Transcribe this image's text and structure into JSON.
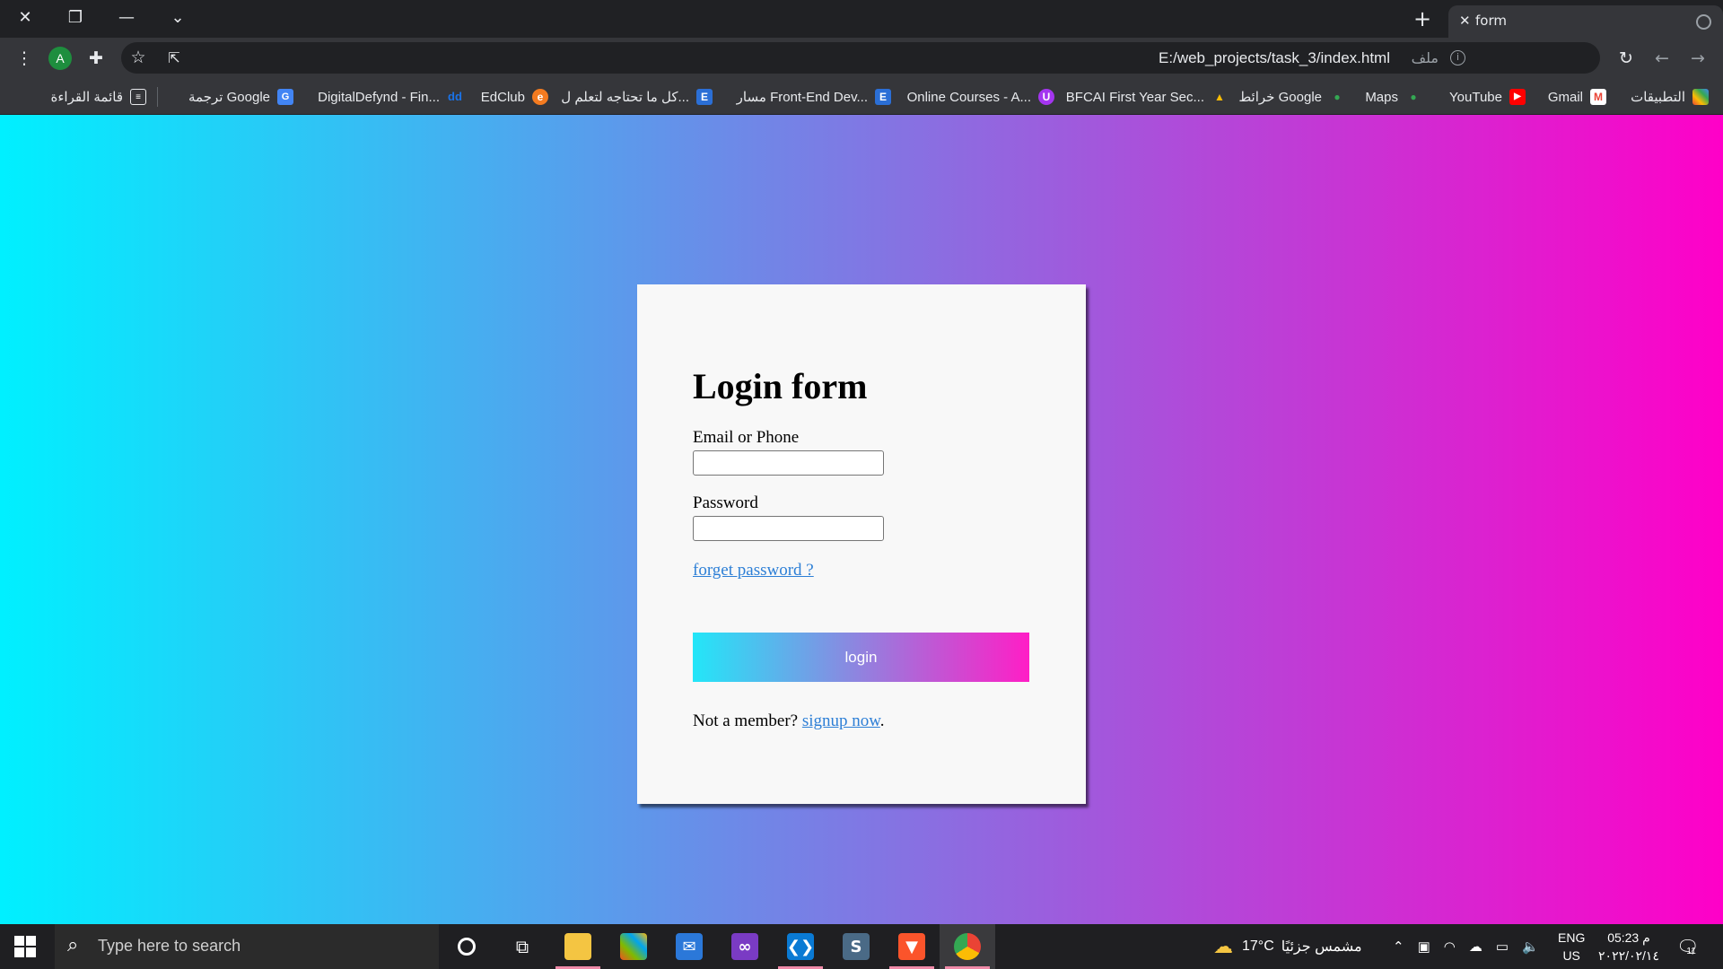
{
  "browser": {
    "tab_title": "form",
    "url": "E:/web_projects/task_3/index.html",
    "site_chip": "ملف",
    "profile_initial": "A"
  },
  "bookmarks": [
    {
      "label": "التطبيقات",
      "icon": "apps-grid-icon",
      "color": "#ea4335"
    },
    {
      "label": "Gmail",
      "icon": "gmail-icon",
      "color": "#ea4335"
    },
    {
      "label": "YouTube",
      "icon": "youtube-icon",
      "color": "#ff0000"
    },
    {
      "label": "Maps",
      "icon": "maps-pin-icon",
      "color": "#34a853"
    },
    {
      "label": "خرائط Google",
      "icon": "maps-pin-icon",
      "color": "#34a853"
    },
    {
      "label": "BFCAI First Year Sec...",
      "icon": "drive-icon",
      "color": "#fbbc04"
    },
    {
      "label": "Online Courses - A...",
      "icon": "udemy-icon",
      "color": "#a435f0"
    },
    {
      "label": "مسار Front-End Dev...",
      "icon": "elzero-icon",
      "color": "#2b6fd6"
    },
    {
      "label": "كل ما تحتاجه لتعلم ل...",
      "icon": "elzero-icon",
      "color": "#2b6fd6"
    },
    {
      "label": "EdClub",
      "icon": "edclub-icon",
      "color": "#f47b20"
    },
    {
      "label": "DigitalDefynd - Fin...",
      "icon": "dd-icon",
      "color": "#1a73e8"
    },
    {
      "label": "ترجمة Google",
      "icon": "translate-icon",
      "color": "#4285f4"
    },
    {
      "label": "قائمة القراءة",
      "icon": "reading-list-icon",
      "color": "#e8eaed"
    }
  ],
  "form": {
    "title": "Login form",
    "email_label": "Email or Phone",
    "email_value": "",
    "password_label": "Password",
    "password_value": "",
    "forget_link": "forget password ?",
    "login_button": "login",
    "member_text": "Not a member? ",
    "signup_link": "signup now",
    "member_suffix": "."
  },
  "colors": {
    "page_gradient_start": "#00f0ff",
    "page_gradient_end": "#ff00c8",
    "link": "#2d7fd6"
  },
  "taskbar": {
    "search_placeholder": "Type here to search",
    "apps": [
      {
        "name": "cortana-icon"
      },
      {
        "name": "task-view-icon"
      },
      {
        "name": "file-explorer-icon"
      },
      {
        "name": "microsoft-store-icon"
      },
      {
        "name": "mail-icon"
      },
      {
        "name": "visual-studio-icon"
      },
      {
        "name": "vscode-icon"
      },
      {
        "name": "sql-server-icon"
      },
      {
        "name": "brave-icon"
      },
      {
        "name": "chrome-icon"
      }
    ],
    "weather_temp": "17°C",
    "weather_text": "مشمس جزئيًا",
    "language": "ENG",
    "region": "US",
    "time": "05:23 م",
    "date": "٢٠٢٢/٠٢/١٤",
    "notification_count": "11"
  }
}
